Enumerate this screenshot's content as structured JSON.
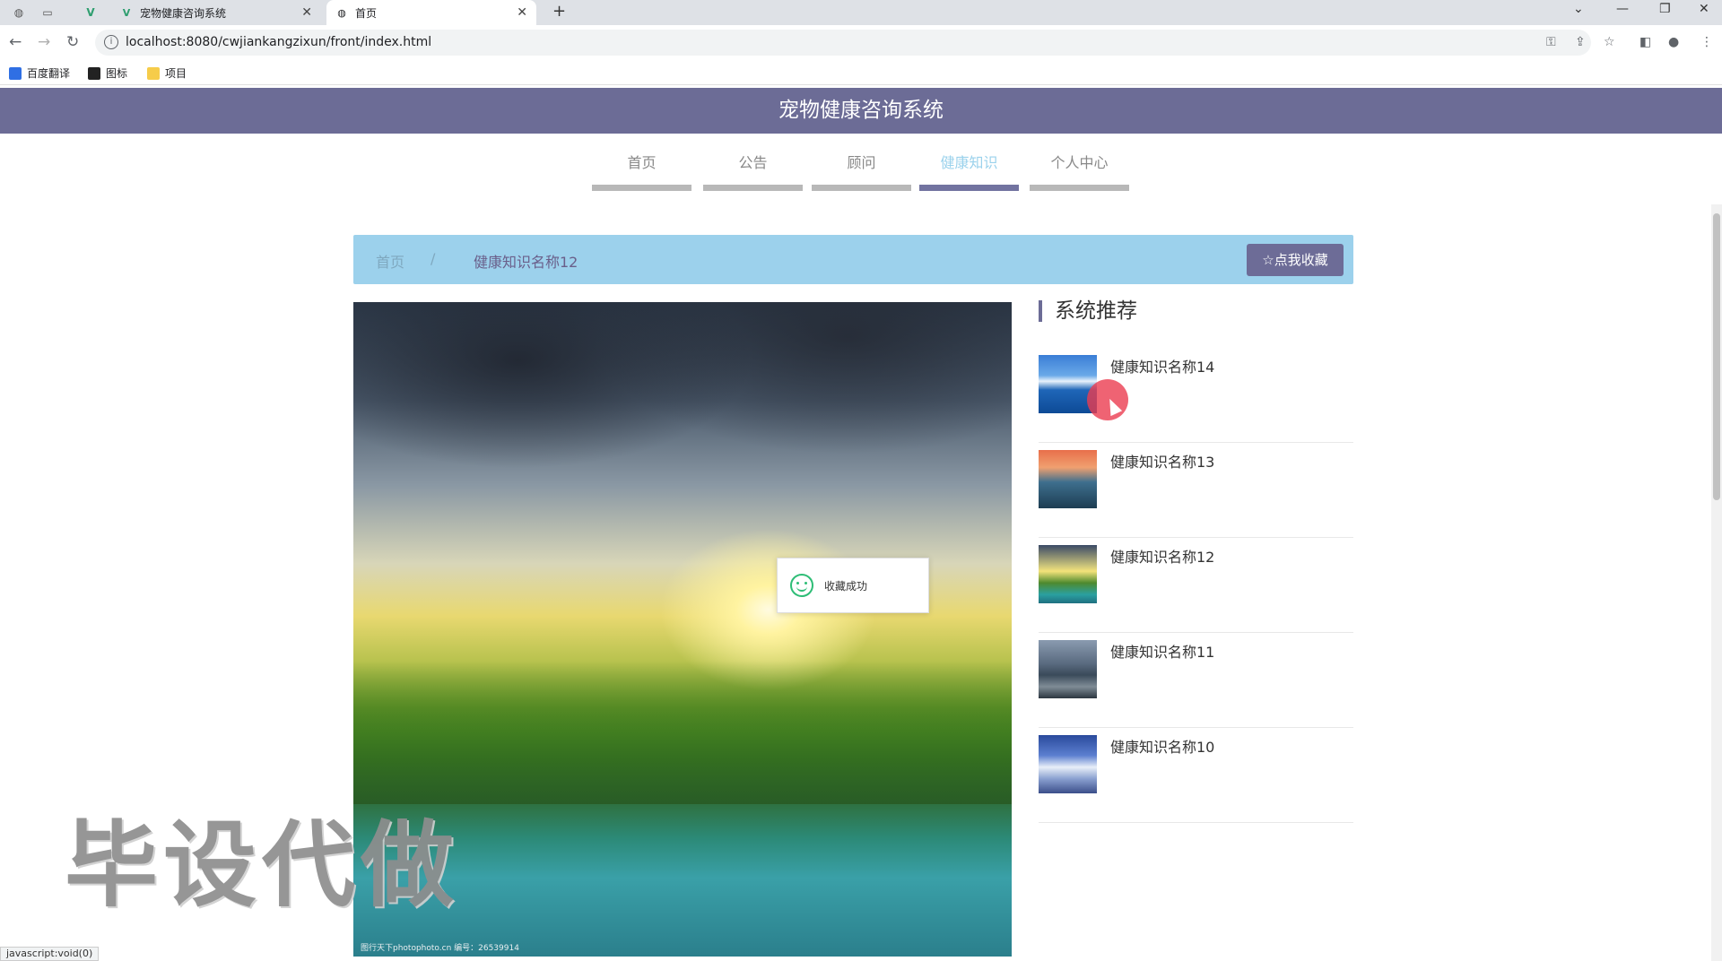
{
  "browser": {
    "tabs": [
      {
        "title": "宠物健康咨询系统",
        "active": false
      },
      {
        "title": "首页",
        "active": true
      }
    ],
    "new_tab_icon": "+",
    "url": "localhost:8080/cwjiankangzixun/front/index.html",
    "bookmarks": [
      "百度翻译",
      "图标",
      "项目"
    ],
    "status_text": "javascript:void(0)"
  },
  "header": {
    "title": "宠物健康咨询系统"
  },
  "nav": {
    "items": [
      {
        "label": "首页",
        "active": false
      },
      {
        "label": "公告",
        "active": false
      },
      {
        "label": "顾问",
        "active": false
      },
      {
        "label": "健康知识",
        "active": true
      },
      {
        "label": "个人中心",
        "active": false
      }
    ]
  },
  "breadcrumb": {
    "home": "首页",
    "separator": "/",
    "current": "健康知识名称12"
  },
  "favorite_button": {
    "label": "☆点我收藏"
  },
  "main_image": {
    "credit": "图行天下photophoto.cn  编号：26539914"
  },
  "toast": {
    "message": "收藏成功"
  },
  "sidebar": {
    "title": "系统推荐",
    "items": [
      {
        "name": "健康知识名称14"
      },
      {
        "name": "健康知识名称13"
      },
      {
        "name": "健康知识名称12"
      },
      {
        "name": "健康知识名称11"
      },
      {
        "name": "健康知识名称10"
      }
    ]
  },
  "watermark": "毕设代做",
  "colors": {
    "header": "#6c6c96",
    "breadcrumb_bg": "#9cd1ec",
    "active_nav": "#9bd2ec",
    "toast_icon": "#2ebd76"
  }
}
